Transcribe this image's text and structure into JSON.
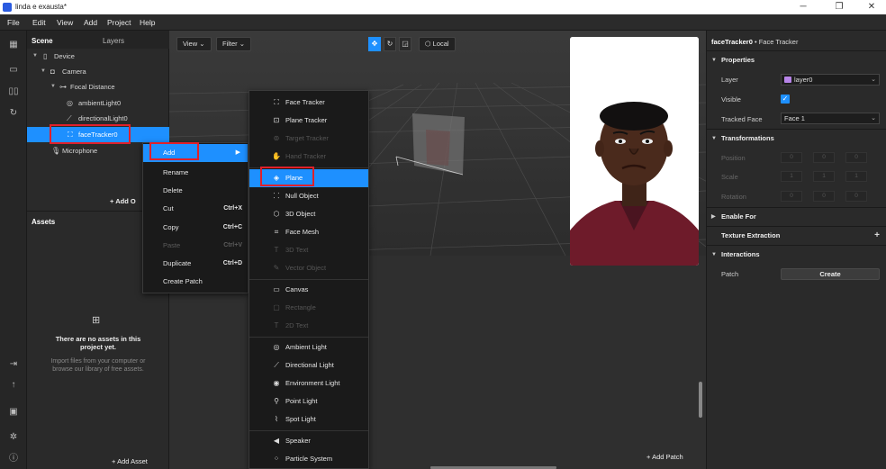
{
  "window": {
    "title": "linda e exausta*"
  },
  "menubar": {
    "items": [
      "File",
      "Edit",
      "View",
      "Add",
      "Project",
      "Help"
    ]
  },
  "scene_panel": {
    "tabs": [
      "Scene",
      "Layers"
    ],
    "tree": [
      {
        "label": "Device",
        "icon": "device-icon"
      },
      {
        "label": "Camera",
        "icon": "camera-icon"
      },
      {
        "label": "Focal Distance",
        "icon": "focal-distance-icon"
      },
      {
        "label": "ambientLight0",
        "icon": "ambient-light-icon"
      },
      {
        "label": "directionalLight0",
        "icon": "directional-light-icon"
      },
      {
        "label": "faceTracker0",
        "icon": "face-tracker-icon"
      },
      {
        "label": "Microphone",
        "icon": "microphone-icon"
      }
    ],
    "add_label": "Add O"
  },
  "assets_panel": {
    "title": "Assets",
    "empty_title": "There are no assets in this project yet.",
    "empty_desc": "Import files from your computer or browse our library of free assets.",
    "add_asset_label": "Add Asset"
  },
  "viewport": {
    "view_label": "View",
    "filter_label": "Filter",
    "local_label": "Local",
    "add_patch_label": "Add Patch"
  },
  "context_menu": {
    "items": [
      {
        "label": "Add",
        "shortcut": "",
        "disabled": false
      },
      {
        "label": "Rename",
        "shortcut": "",
        "disabled": false
      },
      {
        "label": "Delete",
        "shortcut": "",
        "disabled": false
      },
      {
        "label": "Cut",
        "shortcut": "Ctrl+X",
        "disabled": false
      },
      {
        "label": "Copy",
        "shortcut": "Ctrl+C",
        "disabled": false
      },
      {
        "label": "Paste",
        "shortcut": "Ctrl+V",
        "disabled": true
      },
      {
        "label": "Duplicate",
        "shortcut": "Ctrl+D",
        "disabled": false
      },
      {
        "label": "Create Patch",
        "shortcut": "",
        "disabled": false
      }
    ]
  },
  "add_submenu": {
    "items": [
      {
        "label": "Face Tracker",
        "icon": "face-tracker-icon",
        "disabled": false
      },
      {
        "label": "Plane Tracker",
        "icon": "plane-tracker-icon",
        "disabled": false
      },
      {
        "label": "Target Tracker",
        "icon": "target-tracker-icon",
        "disabled": true
      },
      {
        "label": "Hand Tracker",
        "icon": "hand-tracker-icon",
        "disabled": true
      },
      {
        "label": "Plane",
        "icon": "plane-icon",
        "disabled": false
      },
      {
        "label": "Null Object",
        "icon": "null-object-icon",
        "disabled": false
      },
      {
        "label": "3D Object",
        "icon": "3d-object-icon",
        "disabled": false
      },
      {
        "label": "Face Mesh",
        "icon": "face-mesh-icon",
        "disabled": false
      },
      {
        "label": "3D Text",
        "icon": "3d-text-icon",
        "disabled": true
      },
      {
        "label": "Vector Object",
        "icon": "vector-object-icon",
        "disabled": true
      },
      {
        "label": "Canvas",
        "icon": "canvas-icon",
        "disabled": false
      },
      {
        "label": "Rectangle",
        "icon": "rectangle-icon",
        "disabled": true
      },
      {
        "label": "2D Text",
        "icon": "2d-text-icon",
        "disabled": true
      },
      {
        "label": "Ambient Light",
        "icon": "ambient-light-icon",
        "disabled": false
      },
      {
        "label": "Directional Light",
        "icon": "directional-light-icon",
        "disabled": false
      },
      {
        "label": "Environment Light",
        "icon": "environment-light-icon",
        "disabled": false
      },
      {
        "label": "Point Light",
        "icon": "point-light-icon",
        "disabled": false
      },
      {
        "label": "Spot Light",
        "icon": "spot-light-icon",
        "disabled": false
      },
      {
        "label": "Speaker",
        "icon": "speaker-icon",
        "disabled": false
      },
      {
        "label": "Particle System",
        "icon": "particle-system-icon",
        "disabled": false
      }
    ]
  },
  "inspector": {
    "object_name": "faceTracker0",
    "object_type": "Face Tracker",
    "sections": {
      "properties": "Properties",
      "transformations": "Transformations",
      "enable_for": "Enable For",
      "texture_extraction": "Texture Extraction",
      "interactions": "Interactions"
    },
    "properties": {
      "layer_label": "Layer",
      "layer_value": "layer0",
      "layer_color": "#b784e8",
      "visible_label": "Visible",
      "visible_checked": true,
      "tracked_face_label": "Tracked Face",
      "tracked_face_value": "Face 1"
    },
    "transform": {
      "position_label": "Position",
      "scale_label": "Scale",
      "rotation_label": "Rotation",
      "position": [
        "0",
        "0",
        "0"
      ],
      "scale": [
        "1",
        "1",
        "1"
      ],
      "rotation": [
        "0",
        "0",
        "0"
      ]
    },
    "interactions": {
      "patch_label": "Patch",
      "create_label": "Create"
    }
  },
  "colors": {
    "accent": "#1e90ff",
    "highlight_box": "#e0202a"
  }
}
